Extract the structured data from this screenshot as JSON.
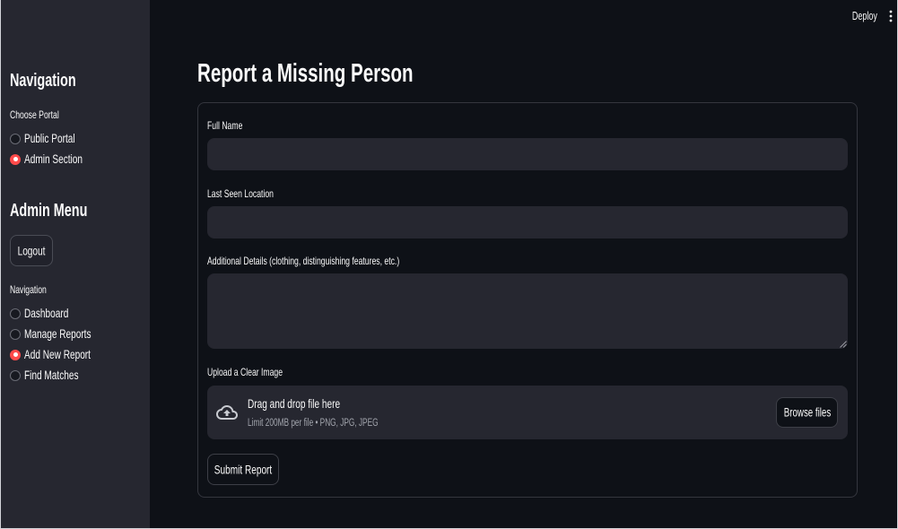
{
  "header": {
    "deploy_label": "Deploy",
    "menu_icon": "vertical-dots-icon"
  },
  "sidebar": {
    "title": "Navigation",
    "portal_label": "Choose Portal",
    "portal_options": [
      {
        "label": "Public Portal",
        "selected": false
      },
      {
        "label": "Admin Section",
        "selected": true
      }
    ],
    "admin_menu_title": "Admin Menu",
    "logout_label": "Logout",
    "nav_label": "Navigation",
    "nav_options": [
      {
        "label": "Dashboard",
        "selected": false
      },
      {
        "label": "Manage Reports",
        "selected": false
      },
      {
        "label": "Add New Report",
        "selected": true
      },
      {
        "label": "Find Matches",
        "selected": false
      }
    ]
  },
  "main": {
    "title": "Report a Missing Person",
    "form": {
      "full_name": {
        "label": "Full Name",
        "value": ""
      },
      "last_seen_location": {
        "label": "Last Seen Location",
        "value": ""
      },
      "additional_details": {
        "label": "Additional Details (clothing, distinguishing features, etc.)",
        "value": "",
        "resize_icon": "resize-grip-icon"
      },
      "image_upload": {
        "label": "Upload a Clear Image",
        "icon": "cloud-upload-icon",
        "dropzone_text": "Drag and drop file here",
        "limit_text": "Limit 200MB per file • PNG, JPG, JPEG",
        "browse_label": "Browse files"
      },
      "submit_label": "Submit Report"
    }
  },
  "colors": {
    "accent": "#ff4b4b",
    "background": "#0e1117",
    "sidebar_background": "#262730",
    "input_background": "#262730",
    "text": "#fafafa"
  }
}
